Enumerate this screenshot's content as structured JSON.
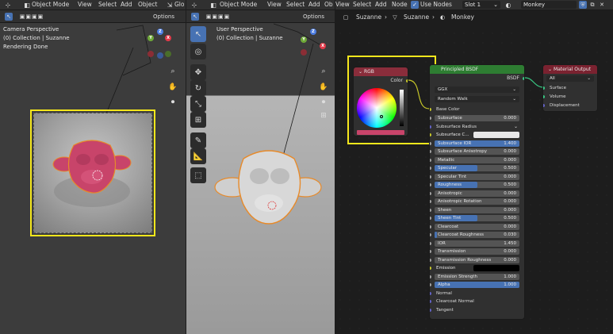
{
  "left_viewport": {
    "mode": "Object Mode",
    "menus": [
      "View",
      "Select",
      "Add",
      "Object",
      "Glo"
    ],
    "options": "Options",
    "overlay": [
      "Camera Perspective",
      "(0) Collection | Suzanne",
      "Rendering Done"
    ]
  },
  "mid_viewport": {
    "mode": "Object Mode",
    "menus": [
      "View",
      "Select",
      "Add",
      "Ob"
    ],
    "options": "Options",
    "overlay": [
      "User Perspective",
      "(0) Collection | Suzanne"
    ]
  },
  "node_editor": {
    "menus": [
      "View",
      "Select",
      "Add",
      "Node"
    ],
    "use_nodes": "Use Nodes",
    "slot": "Slot 1",
    "material": "Monkey",
    "breadcrumb": [
      "Suzanne",
      "Suzanne",
      "Monkey"
    ]
  },
  "rgb_node": {
    "title": "RGB",
    "output": "Color"
  },
  "bsdf_node": {
    "title": "Principled BSDF",
    "output": "BSDF",
    "distribution": "GGX",
    "subsurface_method": "Random Walk",
    "base_color": "Base Color",
    "rows": [
      {
        "label": "Subsurface",
        "value": "0.000",
        "fill": 0
      },
      {
        "label": "Subsurface Radius",
        "value": "",
        "fill": 0
      },
      {
        "label": "Subsurface C...",
        "value": "",
        "fill": 0
      },
      {
        "label": "Subsurface IOR",
        "value": "1.400",
        "fill": 1
      },
      {
        "label": "Subsurface Anisotropy",
        "value": "0.000",
        "fill": 0
      },
      {
        "label": "Metallic",
        "value": "0.000",
        "fill": 0
      },
      {
        "label": "Specular",
        "value": "0.500",
        "fill": 0.5
      },
      {
        "label": "Specular Tint",
        "value": "0.000",
        "fill": 0
      },
      {
        "label": "Roughness",
        "value": "0.500",
        "fill": 0.5
      },
      {
        "label": "Anisotropic",
        "value": "0.000",
        "fill": 0
      },
      {
        "label": "Anisotropic Rotation",
        "value": "0.000",
        "fill": 0
      },
      {
        "label": "Sheen",
        "value": "0.000",
        "fill": 0
      },
      {
        "label": "Sheen Tint",
        "value": "0.500",
        "fill": 0.5
      },
      {
        "label": "Clearcoat",
        "value": "0.000",
        "fill": 0
      },
      {
        "label": "Clearcoat Roughness",
        "value": "0.030",
        "fill": 0.03
      },
      {
        "label": "IOR",
        "value": "1.450",
        "fill": 0
      },
      {
        "label": "Transmission",
        "value": "0.000",
        "fill": 0
      },
      {
        "label": "Transmission Roughness",
        "value": "0.000",
        "fill": 0
      },
      {
        "label": "Emission",
        "value": "",
        "fill": 0
      },
      {
        "label": "Emission Strength",
        "value": "1.000",
        "fill": 0
      },
      {
        "label": "Alpha",
        "value": "1.000",
        "fill": 1
      },
      {
        "label": "Normal",
        "value": "",
        "fill": 0
      },
      {
        "label": "Clearcoat Normal",
        "value": "",
        "fill": 0
      },
      {
        "label": "Tangent",
        "value": "",
        "fill": 0
      }
    ]
  },
  "output_node": {
    "title": "Material Output",
    "target": "All",
    "inputs": [
      "Surface",
      "Volume",
      "Displacement"
    ]
  },
  "gizmo_axes": {
    "x": "X",
    "y": "Y",
    "z": "Z"
  },
  "colors": {
    "highlight": "#f5e71c",
    "bsdf_header": "#2e7d32",
    "output_header": "#7a2230",
    "rgb_header": "#8a2d3b",
    "accent": "#4772b3",
    "suzanne_render": "#c8446a",
    "selection": "#e78a2a"
  }
}
